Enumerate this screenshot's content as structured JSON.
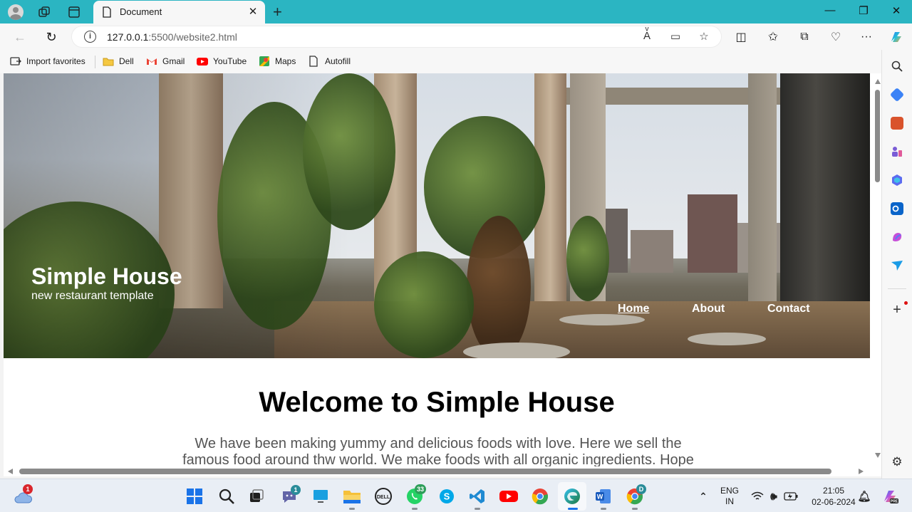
{
  "browser": {
    "tab_title": "Document",
    "url_host": "127.0.0.1",
    "url_rest": ":5500/website2.html",
    "favorites": [
      {
        "label": "Import favorites",
        "icon": "import-icon"
      },
      {
        "label": "Dell",
        "icon": "folder-icon"
      },
      {
        "label": "Gmail",
        "icon": "gmail-icon"
      },
      {
        "label": "YouTube",
        "icon": "youtube-icon"
      },
      {
        "label": "Maps",
        "icon": "maps-icon"
      },
      {
        "label": "Autofill",
        "icon": "document-icon"
      }
    ]
  },
  "site": {
    "brand_title": "Simple House",
    "brand_tagline": "new restaurant template",
    "nav": [
      {
        "label": "Home",
        "active": true
      },
      {
        "label": "About",
        "active": false
      },
      {
        "label": "Contact",
        "active": false
      }
    ],
    "welcome_heading": "Welcome to Simple House",
    "intro_text": "We have been making yummy and delicious foods with love. Here we sell the famous food around thw world. We make foods with all organic ingredients. Hope"
  },
  "taskbar": {
    "weather_badge": "1",
    "teams_badge": "1",
    "whatsapp_badge": "33",
    "chrome_profile_badge": "D",
    "language_line1": "ENG",
    "language_line2": "IN",
    "time": "21:05",
    "date": "02-06-2024",
    "colors": {
      "accent_titlebar": "#2bb5c2",
      "windows_blue": "#1a73e8"
    }
  }
}
